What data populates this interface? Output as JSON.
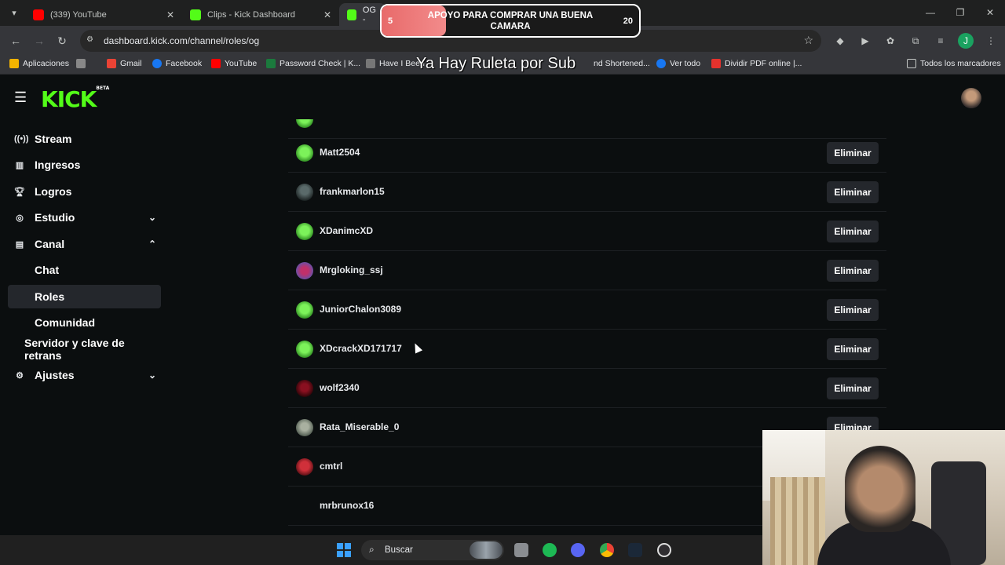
{
  "browser": {
    "tabs": [
      {
        "title": "(339) YouTube",
        "icon": "youtube-icon"
      },
      {
        "title": "Clips - Kick Dashboard",
        "icon": "kick-icon"
      },
      {
        "title": "OG - ",
        "icon": "kick-icon"
      }
    ],
    "url": "dashboard.kick.com/channel/roles/og",
    "bookmarks": [
      "Aplicaciones",
      "Gmail",
      "Facebook",
      "YouTube",
      "Password Check | K...",
      "Have I Been",
      "nd Shortened...",
      "Ver todo",
      "Dividir PDF online |...",
      "Todos los marcadores"
    ]
  },
  "overlay": {
    "goal_title": "APOYO PARA COMPRAR UNA BUENA CAMARA",
    "goal_current": "5",
    "goal_target": "20",
    "goal_progress": 0.25,
    "ruleta": "Ya Hay Ruleta por Sub"
  },
  "sidebar": {
    "items": [
      {
        "label": "Stream",
        "icon": "broadcast-icon"
      },
      {
        "label": "Ingresos",
        "icon": "chart-icon"
      },
      {
        "label": "Logros",
        "icon": "trophy-icon"
      },
      {
        "label": "Estudio",
        "icon": "studio-icon"
      },
      {
        "label": "Canal",
        "icon": "channel-icon"
      },
      {
        "label": "Chat"
      },
      {
        "label": "Roles"
      },
      {
        "label": "Comunidad"
      },
      {
        "label": "Servidor y clave de retrans"
      },
      {
        "label": "Ajustes",
        "icon": "gear-icon"
      }
    ]
  },
  "users": [
    {
      "name": "Matt2504",
      "action": "Eliminar"
    },
    {
      "name": "frankmarlon15",
      "action": "Eliminar"
    },
    {
      "name": "XDanimcXD",
      "action": "Eliminar"
    },
    {
      "name": "Mrgloking_ssj",
      "action": "Eliminar"
    },
    {
      "name": "JuniorChalon3089",
      "action": "Eliminar"
    },
    {
      "name": "XDcrackXD171717",
      "action": "Eliminar"
    },
    {
      "name": "wolf2340",
      "action": "Eliminar"
    },
    {
      "name": "Rata_Miserable_0",
      "action": "Eliminar"
    },
    {
      "name": "cmtrl",
      "action": ""
    },
    {
      "name": "mrbrunox16",
      "action": ""
    }
  ],
  "taskbar": {
    "search_label": "Buscar"
  },
  "colors": {
    "accent": "#53fc18",
    "background": "#0b0e0f",
    "button": "#24272c"
  }
}
